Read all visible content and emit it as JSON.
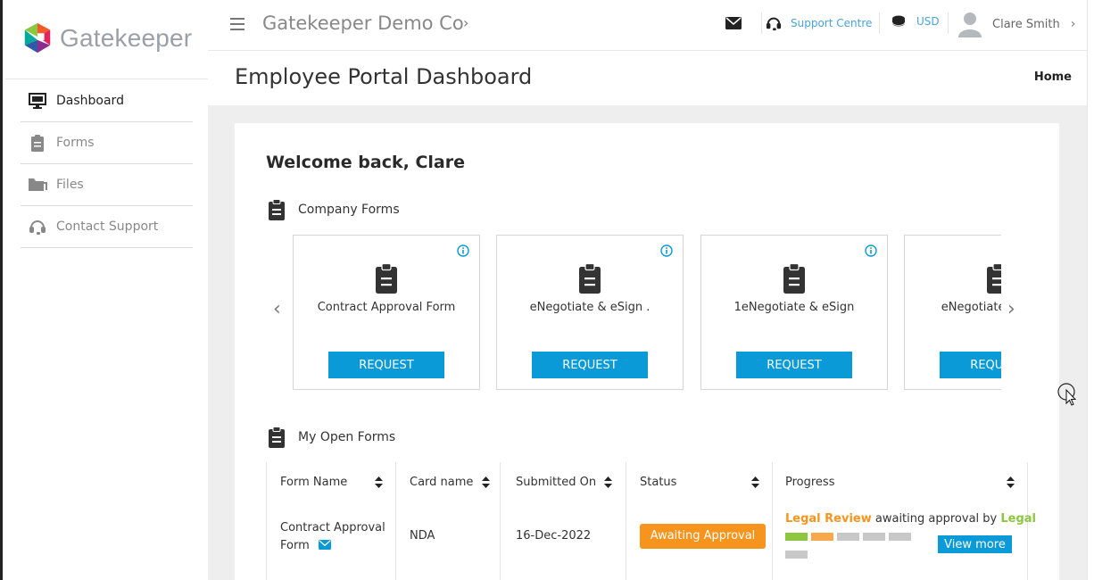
{
  "brand": {
    "name": "Gatekeeper"
  },
  "sidebar": {
    "items": [
      {
        "label": "Dashboard",
        "icon": "monitor-icon",
        "active": true
      },
      {
        "label": "Forms",
        "icon": "clipboard-icon",
        "active": false
      },
      {
        "label": "Files",
        "icon": "folder-icon",
        "active": false
      },
      {
        "label": "Contact Support",
        "icon": "headset-icon",
        "active": false
      }
    ]
  },
  "topbar": {
    "company": "Gatekeeper Demo Co",
    "support_label": "Support Centre",
    "currency_label": "USD",
    "user_name": "Clare Smith"
  },
  "page": {
    "title": "Employee Portal Dashboard",
    "breadcrumb": "Home",
    "welcome": "Welcome back, Clare"
  },
  "company_forms": {
    "heading": "Company Forms",
    "tiles": [
      {
        "name": "Contract Approval Form",
        "button": "REQUEST"
      },
      {
        "name": "eNegotiate & eSign .",
        "button": "REQUEST"
      },
      {
        "name": "1eNegotiate & eSign",
        "button": "REQUEST"
      },
      {
        "name": "eNegotiate & eSign",
        "button": "REQUEST"
      }
    ]
  },
  "open_forms": {
    "heading": "My Open Forms",
    "columns": [
      "Form Name",
      "Card name",
      "Submitted On",
      "Status",
      "Progress"
    ],
    "rows": [
      {
        "form_name": "Contract Approval Form",
        "card_name": "NDA",
        "submitted_on": "16-Dec-2022",
        "status": "Awaiting Approval",
        "progress_stage": "Legal Review",
        "progress_middle": " awaiting approval by ",
        "progress_who": "Legal",
        "view_more": "View more"
      }
    ]
  },
  "colors": {
    "accent": "#0a9ad7",
    "status_orange": "#f7941d",
    "done_green": "#8dc63f",
    "pending_grey": "#c8c8c8",
    "link_blue": "#4aa3d8"
  }
}
